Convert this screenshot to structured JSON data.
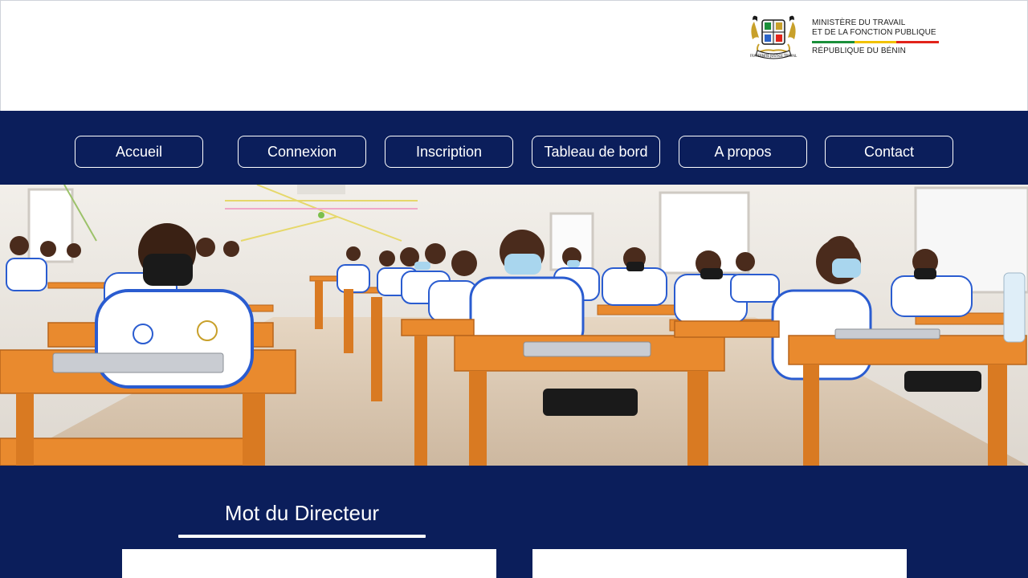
{
  "header": {
    "ministry_line1": "MINISTÈRE DU TRAVAIL",
    "ministry_line2": "ET DE LA FONCTION PUBLIQUE",
    "country": "RÉPUBLIQUE DU BÉNIN",
    "flag_colors": [
      "#1a8f3a",
      "#f2c200",
      "#e2231a"
    ],
    "emblem": "coat-of-arms-icon"
  },
  "nav": {
    "items": [
      {
        "label": "Accueil"
      },
      {
        "label": "Connexion"
      },
      {
        "label": "Inscription"
      },
      {
        "label": "Tableau de bord"
      },
      {
        "label": "A propos"
      },
      {
        "label": "Contact"
      }
    ]
  },
  "hero": {
    "image": "classroom-photo"
  },
  "director_section": {
    "title": "Mot du Directeur"
  },
  "colors": {
    "navy": "#0b1e5b",
    "white": "#ffffff",
    "desk_orange": "#e98a2e"
  }
}
